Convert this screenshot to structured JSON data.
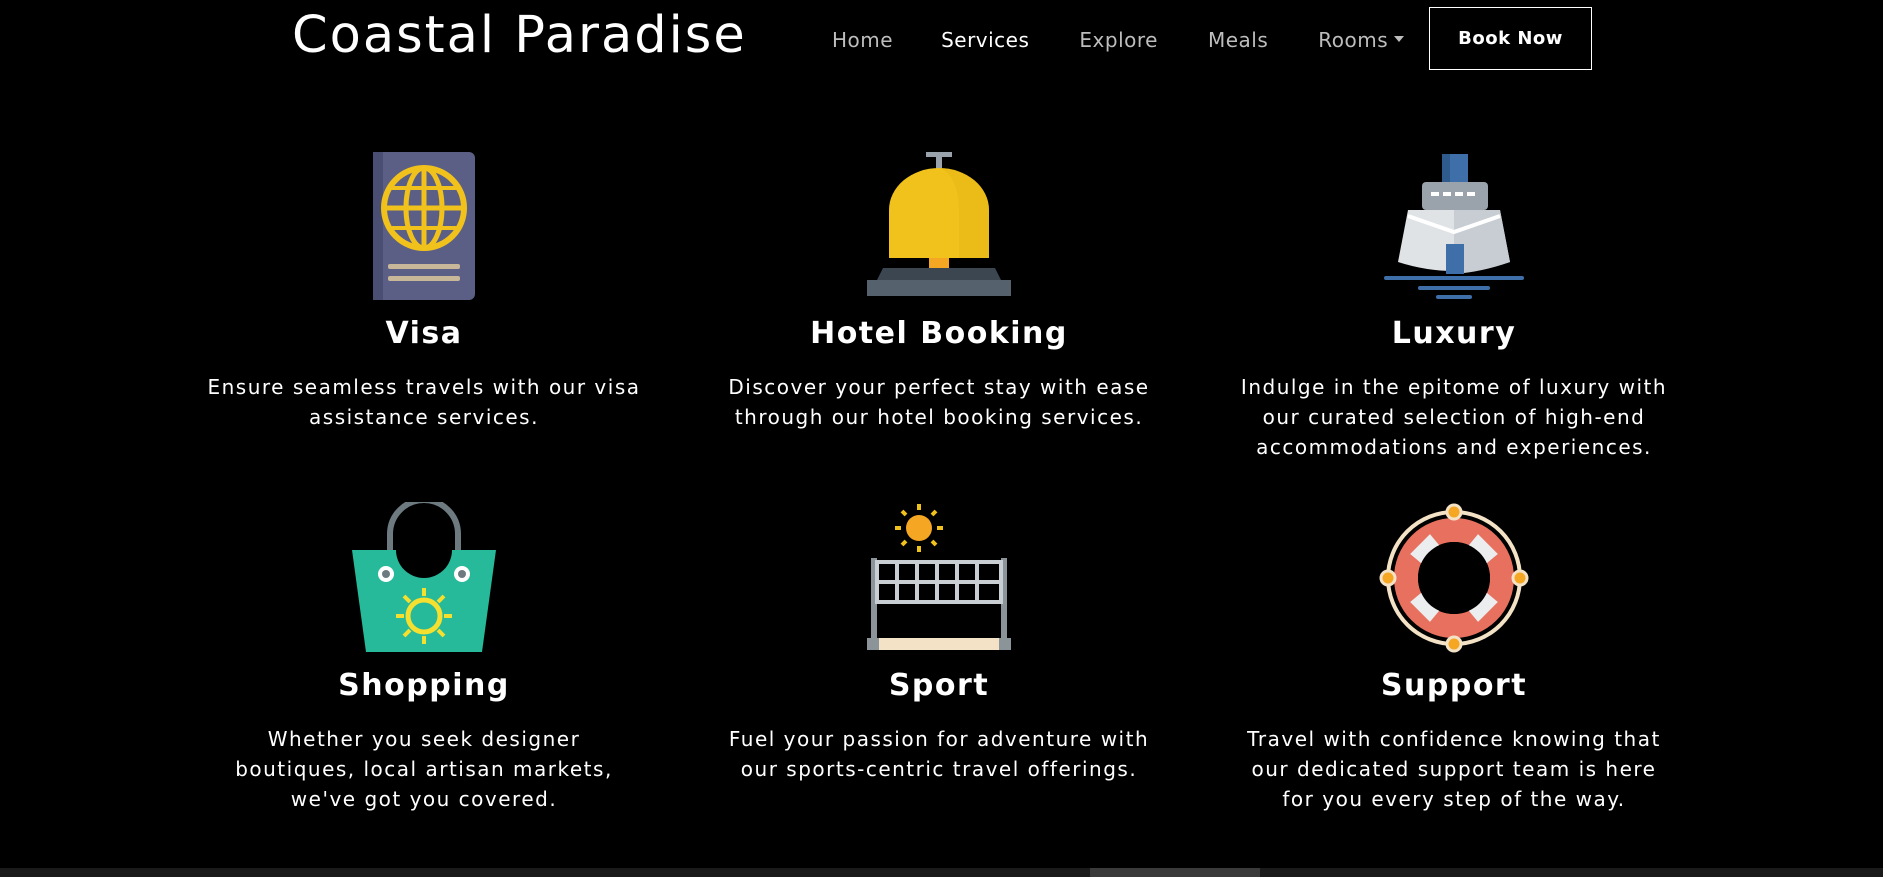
{
  "brand": "Coastal Paradise",
  "nav": {
    "items": [
      {
        "label": "Home"
      },
      {
        "label": "Services"
      },
      {
        "label": "Explore"
      },
      {
        "label": "Meals"
      },
      {
        "label": "Rooms"
      }
    ],
    "book_label": "Book Now"
  },
  "services": [
    {
      "title": "Visa",
      "desc": "Ensure seamless travels with our visa assistance services.",
      "icon": "passport-icon"
    },
    {
      "title": "Hotel Booking",
      "desc": "Discover your perfect stay with ease through our hotel booking services.",
      "icon": "service-bell-icon"
    },
    {
      "title": "Luxury",
      "desc": "Indulge in the epitome of luxury with our curated selection of high-end accommodations and experiences.",
      "icon": "cruise-ship-icon"
    },
    {
      "title": "Shopping",
      "desc": "Whether you seek designer boutiques, local artisan markets, we've got you covered.",
      "icon": "shopping-bag-icon"
    },
    {
      "title": "Sport",
      "desc": "Fuel your passion for adventure with our sports-centric travel offerings.",
      "icon": "volleyball-net-icon"
    },
    {
      "title": "Support",
      "desc": "Travel with confidence knowing that our dedicated support team is here for you every step of the way.",
      "icon": "lifebuoy-icon"
    }
  ],
  "colors": {
    "background": "#000000",
    "text": "#ffffff",
    "nav_inactive": "#bdbdbd",
    "accent_yellow": "#f1c21b",
    "passport": "#5b5f86",
    "bag": "#26b99a",
    "lifebuoy": "#e8705f"
  }
}
